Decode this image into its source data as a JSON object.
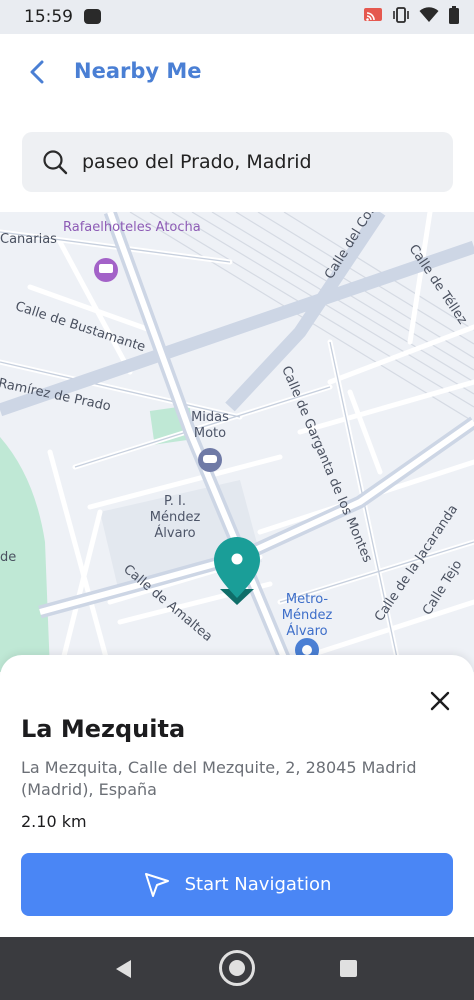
{
  "status_bar": {
    "time": "15:59",
    "icons": [
      "notification-dot-icon",
      "cast-icon",
      "vibrate-icon",
      "wifi-icon",
      "battery-icon"
    ]
  },
  "header": {
    "title": "Nearby Me",
    "back_icon": "chevron-left-icon"
  },
  "search": {
    "value": "paseo del Prado, Madrid",
    "icon": "search-icon"
  },
  "map": {
    "streets": [
      "Canarias",
      "Calle de Bustamante",
      "Ramírez de Prado",
      "Calle del Comercio",
      "Calle de Téllez",
      "Calle de Garganta de los Montes",
      "Calle de Amaltea",
      "Calle de la Jacaranda",
      "Calle Tejo",
      "de"
    ],
    "pois": {
      "hotel": "Rafaelhoteles Atocha",
      "moto": "Midas Moto",
      "industrial_line1": "P. I.",
      "industrial_line2": "Méndez",
      "industrial_line3": "Álvaro",
      "metro_line1": "Metro-",
      "metro_line2": "Méndez",
      "metro_line3": "Álvaro"
    },
    "marker_color": "#1a9e98"
  },
  "place": {
    "name": "La Mezquita",
    "address": "La Mezquita, Calle del Mezquite, 2, 28045 Madrid (Madrid), España",
    "distance": "2.10 km",
    "close_icon": "close-icon"
  },
  "action": {
    "label": "Start Navigation",
    "icon": "navigation-arrow-icon",
    "color": "#4a86f5"
  },
  "accent_color": "#4a7fd4"
}
